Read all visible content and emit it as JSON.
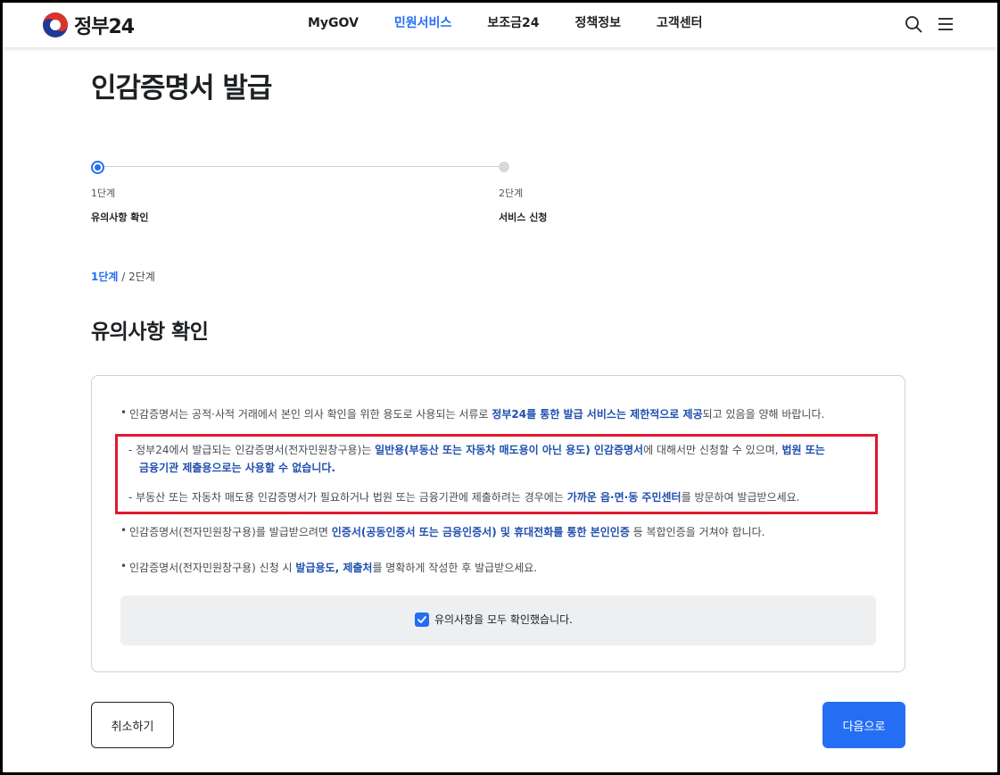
{
  "brand": {
    "name": "정부24"
  },
  "nav": {
    "items": [
      {
        "label": "MyGOV",
        "active": false
      },
      {
        "label": "민원서비스",
        "active": true
      },
      {
        "label": "보조금24",
        "active": false
      },
      {
        "label": "정책정보",
        "active": false
      },
      {
        "label": "고객센터",
        "active": false
      }
    ],
    "icons": [
      "search-icon",
      "menu-icon"
    ]
  },
  "page": {
    "title": "인감증명서 발급"
  },
  "stepper": {
    "steps": [
      {
        "num": "1단계",
        "name": "유의사항 확인",
        "state": "current"
      },
      {
        "num": "2단계",
        "name": "서비스 신청",
        "state": "pending"
      }
    ]
  },
  "breadcrumb": {
    "current": "1단계",
    "separator": "/",
    "total": "2단계"
  },
  "section": {
    "title": "유의사항 확인"
  },
  "notices": {
    "n1": {
      "t1": "인감증명서는 공적·사적 거래에서 본인 의사 확인을 위한 용도로 사용되는 서류로 ",
      "b1": "정부24를 통한 발급 서비스는 제한적으로 제공",
      "t2": "되고 있음을 양해 바랍니다."
    },
    "s1": {
      "t1": "- 정부24에서 발급되는 인감증명서(전자민원창구용)는 ",
      "b1": "일반용(부동산 또는 자동차 매도용이 아닌 용도) 인감증명서",
      "t2": "에 대해서만 신청할 수 있으며, ",
      "b2": "법원 또는",
      "b3": "금융기관 제출용으로는 사용할 수 없습니다."
    },
    "s2": {
      "t1": "- 부동산 또는 자동차 매도용 인감증명서가 필요하거나 법원 또는 금융기관에 제출하려는 경우에는 ",
      "b1": "가까운 읍·면·동 주민센터",
      "t2": "를 방문하여 발급받으세요."
    },
    "n2": {
      "t1": "인감증명서(전자민원창구용)를 발급받으려면 ",
      "b1": "인증서(공동인증서 또는 금융인증서) 및 휴대전화를 통한 본인인증",
      "t2": " 등 복합인증을 거쳐야 합니다."
    },
    "n3": {
      "t1": "인감증명서(전자민원창구용) 신청 시 ",
      "b1": "발급용도, 제출처",
      "t2": "를 명확하게 작성한 후 발급받으세요."
    },
    "bullet": "•"
  },
  "confirm": {
    "label": "유의사항을 모두 확인했습니다.",
    "checked": true
  },
  "buttons": {
    "cancel": "취소하기",
    "next": "다음으로"
  },
  "colors": {
    "accent": "#256ef4",
    "emphasis": "#1f4fae",
    "highlight_border": "#e0192f"
  }
}
